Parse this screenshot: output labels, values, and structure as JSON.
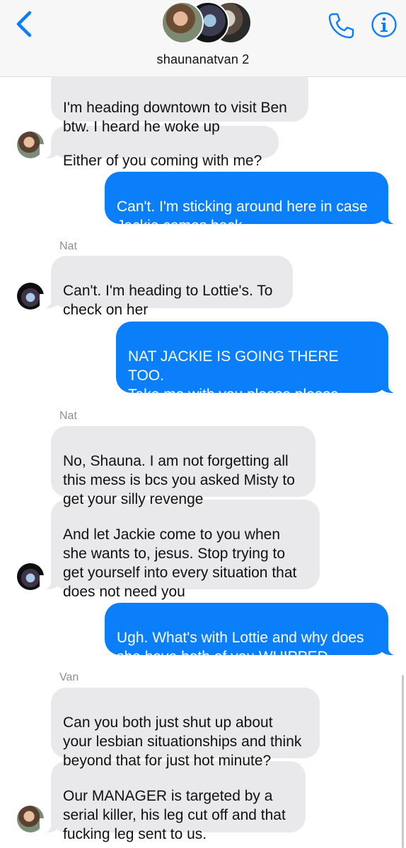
{
  "header": {
    "title": "shaunanatvan 2",
    "back_icon": "chevron-left-icon",
    "call_icon": "phone-icon",
    "info_icon": "info-icon",
    "accent_color": "#0b7ff9"
  },
  "messages": [
    {
      "from": "Shauna",
      "type": "received",
      "text": "I'm heading downtown to visit Ben\nbtw. I heard he woke up"
    },
    {
      "from": "Shauna",
      "type": "received",
      "text": "Either of you coming with me?"
    },
    {
      "from": "me",
      "type": "sent",
      "text": "Can't. I'm sticking around here in case\nJackie comes back"
    },
    {
      "from": "Nat",
      "type": "received",
      "sender_label": "Nat",
      "text": "Can't. I'm heading to Lottie's. To\ncheck on her"
    },
    {
      "from": "me",
      "type": "sent",
      "text": "NAT JACKIE IS GOING THERE TOO.\nTake me with you please please\nplease please please please"
    },
    {
      "from": "Nat",
      "type": "received",
      "sender_label": "Nat",
      "text": "No, Shauna. I am not forgetting all\nthis mess is bcs you asked Misty to\nget your silly revenge"
    },
    {
      "from": "Nat",
      "type": "received",
      "text": "And let Jackie come to you when\nshe wants to, jesus. Stop trying to\nget yourself into every situation that\ndoes not need you"
    },
    {
      "from": "me",
      "type": "sent",
      "text": "Ugh. What's with Lottie and why does\nshe have both of you WHIPPED"
    },
    {
      "from": "Van",
      "type": "received",
      "sender_label": "Van",
      "text": "Can you both just shut up about\nyour lesbian situationships and think\nbeyond that for just hot minute?"
    },
    {
      "from": "Van",
      "type": "received",
      "text": "Our MANAGER is targeted by a\nserial killer, his leg cut off and that\nfucking leg sent to us."
    }
  ]
}
